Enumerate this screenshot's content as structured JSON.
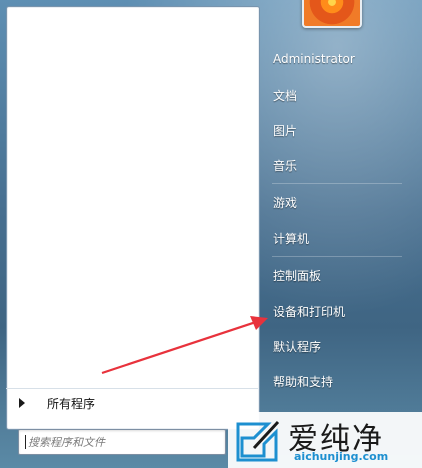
{
  "start_menu": {
    "all_programs_label": "所有程序",
    "search_placeholder": "搜索程序和文件",
    "user_name": "Administrator",
    "right_items": [
      "文档",
      "图片",
      "音乐",
      "游戏",
      "计算机",
      "控制面板",
      "设备和打印机",
      "默认程序",
      "帮助和支持"
    ]
  },
  "watermark": {
    "title": "爱纯净",
    "url": "aichunjing.com"
  },
  "colors": {
    "arrow": "#e8323c",
    "watermark_url": "#1d8fd0"
  },
  "icons": {
    "avatar": "flower-avatar",
    "all_programs": "triangle-right-icon",
    "logo": "aichunjing-logo-icon"
  }
}
